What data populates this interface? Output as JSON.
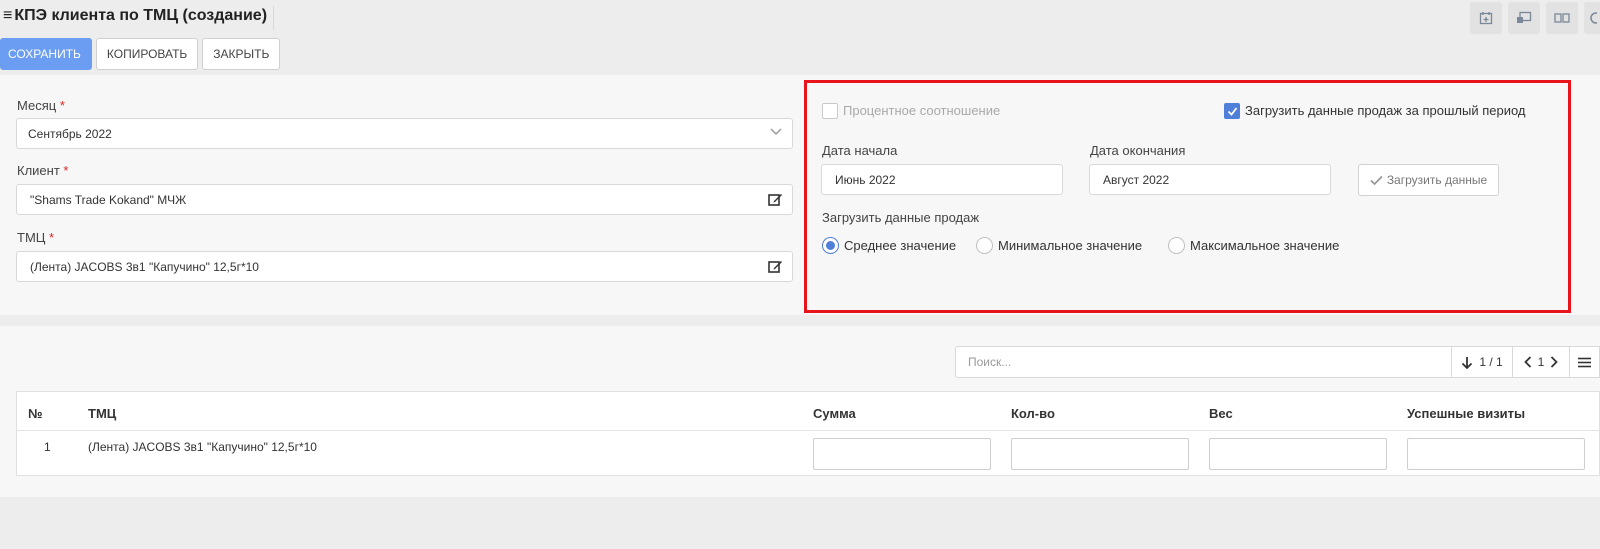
{
  "header": {
    "title": "КПЭ клиента по ТМЦ (создание)",
    "buttons": {
      "save": "СОХРАНИТЬ",
      "copy": "КОПИРОВАТЬ",
      "close": "ЗАКРЫТЬ"
    },
    "top_icons": [
      "calendar-add-icon",
      "screen-share-icon",
      "split-view-icon",
      "circle-icon"
    ]
  },
  "form": {
    "month_label": "Месяц",
    "month_value": "Сентябрь 2022",
    "client_label": "Клиент",
    "client_value": "\"Shams Trade Kokand\" МЧЖ",
    "tmc_label": "ТМЦ",
    "tmc_value": "(Лента) JACOBS 3в1 \"Капучино\" 12,5г*10",
    "required_mark": "*"
  },
  "sales_load": {
    "percent_label": "Процентное соотношение",
    "percent_checked": false,
    "load_prev_label": "Загрузить данные продаж за прошлый период",
    "load_prev_checked": true,
    "start_label": "Дата начала",
    "start_value": "Июнь 2022",
    "end_label": "Дата окончания",
    "end_value": "Август 2022",
    "load_button": "Загрузить данные",
    "load_sales_label": "Загрузить данные продаж",
    "options": [
      "Среднее значение",
      "Минимальное значение",
      "Максимальное значение"
    ],
    "selected_option": "Среднее значение"
  },
  "table": {
    "search_placeholder": "Поиск...",
    "page_info": "1 / 1",
    "page_number": "1",
    "columns": [
      "№",
      "ТМЦ",
      "Сумма",
      "Кол-во",
      "Вес",
      "Успешные визиты"
    ],
    "rows": [
      {
        "num": "1",
        "tmc": "(Лента) JACOBS 3в1 \"Капучино\" 12,5г*10"
      }
    ]
  },
  "colors": {
    "primary": "#6b9df2",
    "highlight_border": "#e8141b",
    "accent": "#4f7fd8"
  }
}
